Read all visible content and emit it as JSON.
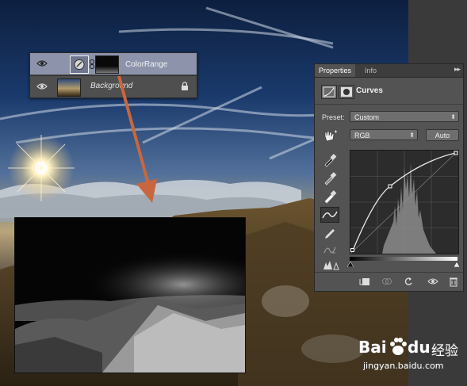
{
  "layers_panel": {
    "layers": [
      {
        "name": "ColorRange",
        "selected": true
      },
      {
        "name": "Background",
        "selected": false,
        "locked": true
      }
    ]
  },
  "properties_panel": {
    "tabs": [
      {
        "label": "Properties",
        "active": true
      },
      {
        "label": "Info",
        "active": false
      }
    ],
    "menu_glyph": "▸▸",
    "adjustment_title": "Curves",
    "preset_label": "Preset:",
    "preset_value": "Custom",
    "channel_value": "RGB",
    "auto_button": "Auto"
  },
  "watermark": {
    "brand": "Bai",
    "brand_suffix": "du",
    "cn": "经验",
    "url": "jingyan.baidu.com"
  },
  "colors": {
    "selected_layer": "#8c93ab",
    "panel_bg": "#535353",
    "arrow": "#c8673f"
  }
}
